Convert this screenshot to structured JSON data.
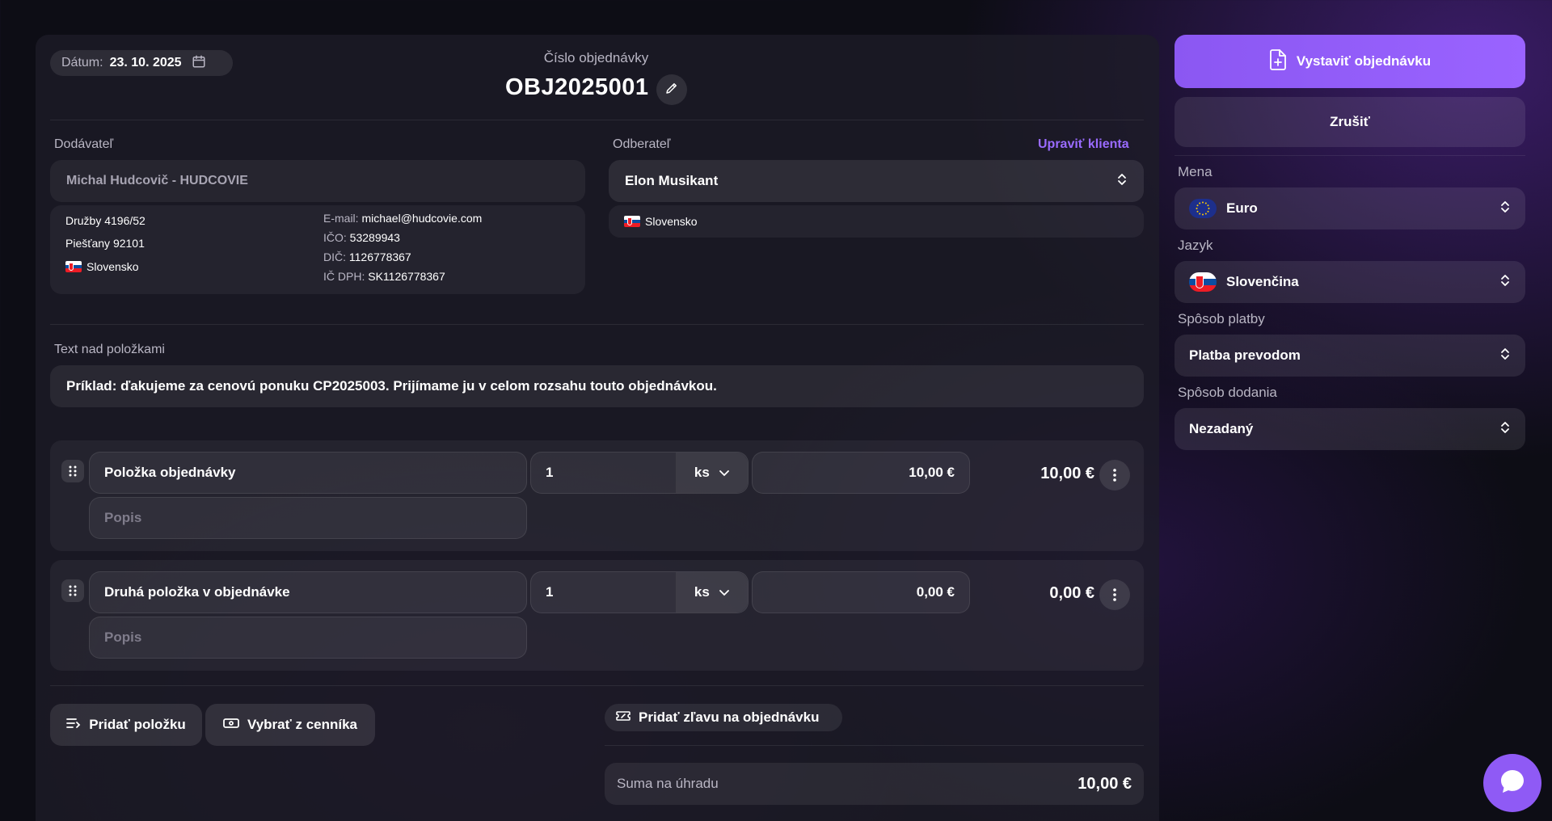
{
  "header": {
    "date_label": "Dátum:",
    "date_value": "23. 10. 2025",
    "order_number_label": "Číslo objednávky",
    "order_number": "OBJ2025001"
  },
  "supplier": {
    "label": "Dodávateľ",
    "name": "Michal Hudcovič - HUDCOVIE",
    "street": "Družby 4196/52",
    "city": "Piešťany 92101",
    "country": "Slovensko",
    "email_key": "E-mail:",
    "email": "michael@hudcovie.com",
    "ico_key": "IČO:",
    "ico": "53289943",
    "dic_key": "DIČ:",
    "dic": "1126778367",
    "icdph_key": "IČ DPH:",
    "icdph": "SK1126778367"
  },
  "customer": {
    "label": "Odberateľ",
    "edit_link": "Upraviť klienta",
    "name": "Elon Musikant",
    "country": "Slovensko"
  },
  "text_above": {
    "label": "Text nad položkami",
    "value": "Príklad: ďakujeme za cenovú ponuku CP2025003. Prijímame ju v celom rozsahu touto objednávkou."
  },
  "items": [
    {
      "name": "Položka objednávky",
      "description_placeholder": "Popis",
      "quantity": "1",
      "unit": "ks",
      "unit_price": "10,00 €",
      "total": "10,00 €"
    },
    {
      "name": "Druhá položka v objednávke",
      "description_placeholder": "Popis",
      "quantity": "1",
      "unit": "ks",
      "unit_price": "0,00 €",
      "total": "0,00 €"
    }
  ],
  "actions": {
    "add_item": "Pridať položku",
    "from_pricelist": "Vybrať z cenníka",
    "add_discount": "Pridať zľavu na objednávku"
  },
  "summary": {
    "label": "Suma na úhradu",
    "value": "10,00 €"
  },
  "sidebar": {
    "issue_button": "Vystaviť objednávku",
    "cancel_button": "Zrušiť",
    "currency_label": "Mena",
    "currency_value": "Euro",
    "language_label": "Jazyk",
    "language_value": "Slovenčina",
    "payment_label": "Spôsob platby",
    "payment_value": "Platba prevodom",
    "delivery_label": "Spôsob dodania",
    "delivery_value": "Nezadaný"
  },
  "colors": {
    "accent": "#9a63ff",
    "background": "#0d0d15",
    "panel": "#1e1c28"
  },
  "icons": [
    "calendar-icon",
    "pencil-icon",
    "chevron-updown-icon",
    "drag-handle-icon",
    "chevron-down-icon",
    "more-vertical-icon",
    "list-add-icon",
    "banknote-icon",
    "ticket-icon",
    "file-plus-icon",
    "chat-icon"
  ]
}
